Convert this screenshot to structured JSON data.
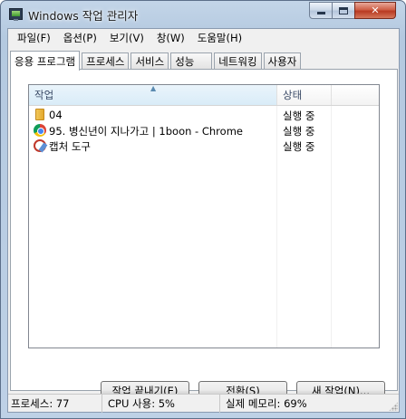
{
  "window": {
    "title": "Windows 작업 관리자",
    "icon": "task-manager-icon",
    "controls": {
      "minimize": "minimize-icon",
      "maximize": "maximize-icon",
      "close": "✕"
    }
  },
  "menu": [
    "파일(F)",
    "옵션(P)",
    "보기(V)",
    "창(W)",
    "도움말(H)"
  ],
  "tabs": [
    {
      "label": "응용 프로그램",
      "active": true
    },
    {
      "label": "프로세스",
      "active": false
    },
    {
      "label": "서비스",
      "active": false
    },
    {
      "label": "성능",
      "active": false
    },
    {
      "label": "네트워킹",
      "active": false
    },
    {
      "label": "사용자",
      "active": false
    }
  ],
  "list": {
    "columns": {
      "task": "작업",
      "status": "상태",
      "sort_indicator": "▲"
    },
    "rows": [
      {
        "icon": "folder-icon",
        "name": "04",
        "status": "실행 중"
      },
      {
        "icon": "chrome-icon",
        "name": "95. 병신년이 지나가고 | 1boon - Chrome",
        "status": "실행 중"
      },
      {
        "icon": "snipping-tool-icon",
        "name": "캡처 도구",
        "status": "실행 중"
      }
    ]
  },
  "buttons": {
    "end_task": "작업 끝내기(E)",
    "switch_to": "전환(S)",
    "new_task": "새 작업(N)..."
  },
  "statusbar": {
    "processes": "프로세스: 77",
    "cpu": "CPU 사용: 5%",
    "memory": "실제 메모리: 69%"
  }
}
